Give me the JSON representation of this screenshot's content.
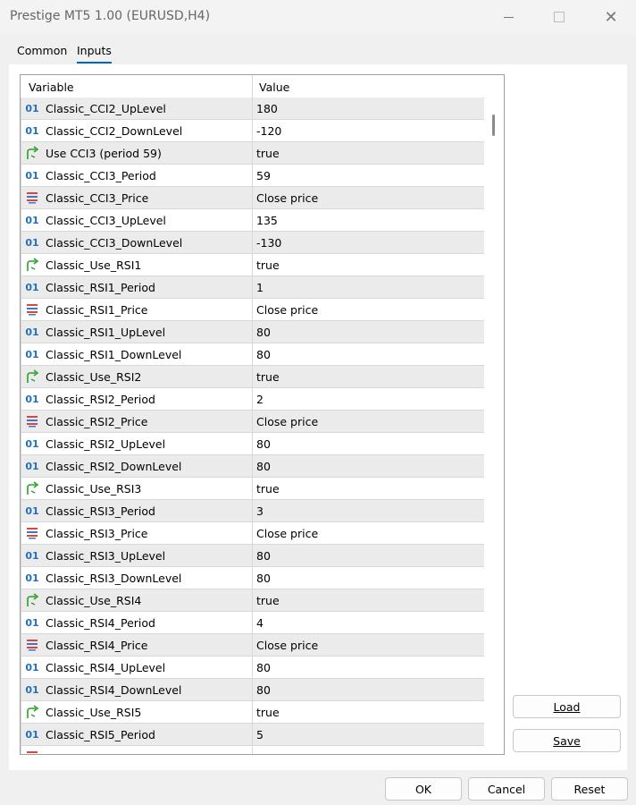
{
  "window": {
    "title": "Prestige MT5 1.00 (EURUSD,H4)",
    "close_glyph": "✕"
  },
  "tabs": [
    {
      "label": "Common"
    },
    {
      "label": "Inputs"
    }
  ],
  "grid": {
    "columns": [
      "Variable",
      "Value"
    ],
    "rows": [
      {
        "icon": "integer-icon",
        "variable": "Classic_CCI2_UpLevel",
        "value": "180"
      },
      {
        "icon": "integer-icon",
        "variable": "Classic_CCI2_DownLevel",
        "value": "-120"
      },
      {
        "icon": "bool-arrow-icon",
        "variable": "Use CCI3 (period 59)",
        "value": "true"
      },
      {
        "icon": "integer-icon",
        "variable": "Classic_CCI3_Period",
        "value": "59"
      },
      {
        "icon": "enum-icon",
        "variable": "Classic_CCI3_Price",
        "value": "Close price"
      },
      {
        "icon": "integer-icon",
        "variable": "Classic_CCI3_UpLevel",
        "value": "135"
      },
      {
        "icon": "integer-icon",
        "variable": "Classic_CCI3_DownLevel",
        "value": "-130"
      },
      {
        "icon": "bool-arrow-icon",
        "variable": "Classic_Use_RSI1",
        "value": "true"
      },
      {
        "icon": "integer-icon",
        "variable": "Classic_RSI1_Period",
        "value": "1"
      },
      {
        "icon": "enum-icon",
        "variable": "Classic_RSI1_Price",
        "value": "Close price"
      },
      {
        "icon": "integer-icon",
        "variable": "Classic_RSI1_UpLevel",
        "value": "80"
      },
      {
        "icon": "integer-icon",
        "variable": "Classic_RSI1_DownLevel",
        "value": "80"
      },
      {
        "icon": "bool-arrow-icon",
        "variable": "Classic_Use_RSI2",
        "value": "true"
      },
      {
        "icon": "integer-icon",
        "variable": "Classic_RSI2_Period",
        "value": "2"
      },
      {
        "icon": "enum-icon",
        "variable": "Classic_RSI2_Price",
        "value": "Close price"
      },
      {
        "icon": "integer-icon",
        "variable": "Classic_RSI2_UpLevel",
        "value": "80"
      },
      {
        "icon": "integer-icon",
        "variable": "Classic_RSI2_DownLevel",
        "value": "80"
      },
      {
        "icon": "bool-arrow-icon",
        "variable": "Classic_Use_RSI3",
        "value": "true"
      },
      {
        "icon": "integer-icon",
        "variable": "Classic_RSI3_Period",
        "value": "3"
      },
      {
        "icon": "enum-icon",
        "variable": "Classic_RSI3_Price",
        "value": "Close price"
      },
      {
        "icon": "integer-icon",
        "variable": "Classic_RSI3_UpLevel",
        "value": "80"
      },
      {
        "icon": "integer-icon",
        "variable": "Classic_RSI3_DownLevel",
        "value": "80"
      },
      {
        "icon": "bool-arrow-icon",
        "variable": "Classic_Use_RSI4",
        "value": "true"
      },
      {
        "icon": "integer-icon",
        "variable": "Classic_RSI4_Period",
        "value": "4"
      },
      {
        "icon": "enum-icon",
        "variable": "Classic_RSI4_Price",
        "value": "Close price"
      },
      {
        "icon": "integer-icon",
        "variable": "Classic_RSI4_UpLevel",
        "value": "80"
      },
      {
        "icon": "integer-icon",
        "variable": "Classic_RSI4_DownLevel",
        "value": "80"
      },
      {
        "icon": "bool-arrow-icon",
        "variable": "Classic_Use_RSI5",
        "value": "true"
      },
      {
        "icon": "integer-icon",
        "variable": "Classic_RSI5_Period",
        "value": "5"
      },
      {
        "icon": "enum-icon",
        "variable": "",
        "value": ""
      }
    ]
  },
  "side_buttons": {
    "load_label": "Load",
    "save_label": "Save"
  },
  "footer_buttons": {
    "ok_label": "OK",
    "cancel_label": "Cancel",
    "reset_label": "Reset"
  },
  "colors": {
    "accent": "#0067c0",
    "integer_icon": "#1f6fc1",
    "bool_icon": "#2aa02a",
    "enum_icon_red": "#d9463e",
    "enum_icon_blue": "#3a78c9"
  }
}
